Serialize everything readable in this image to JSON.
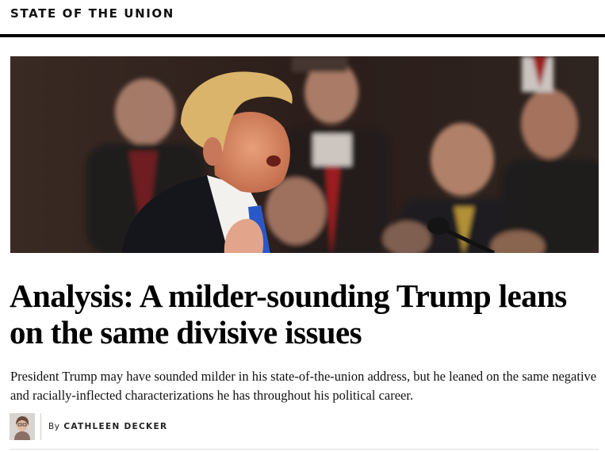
{
  "section": {
    "label": "STATE OF THE UNION"
  },
  "article": {
    "headline": "Analysis: A milder-sounding Trump leans on the same divisive issues",
    "dek": "President Trump may have sounded milder in his state-of-the-union address, but he leaned on the same negative and racially-inflected characterizations he has throughout his political career.",
    "byline_prefix": "By",
    "author": "CATHLEEN DECKER"
  },
  "colors": {
    "rule": "#000000",
    "text": "#111111"
  }
}
